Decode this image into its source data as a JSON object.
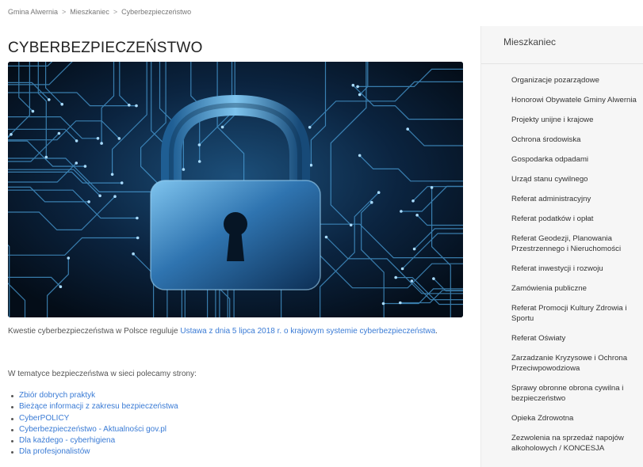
{
  "breadcrumb": {
    "items": [
      "Gmina Alwernia",
      "Mieszkaniec",
      "Cyberbezpieczeństwo"
    ],
    "separator": ">"
  },
  "page": {
    "title": "CYBERBEZPIECZEŃSTWO"
  },
  "hero": {
    "icon": "padlock-circuit-icon"
  },
  "intro": {
    "text": "Kwestie cyberbezpieczeństwa w Polsce reguluje ",
    "link": "Ustawa z dnia 5 lipca 2018 r. o krajowym systemie cyberbezpieczeństwa",
    "end": "."
  },
  "recommend": {
    "text": "W tematyce bezpieczeństwa w sieci polecamy strony:"
  },
  "links": [
    "Zbiór dobrych praktyk",
    "Bieżące informacji z zakresu bezpieczeństwa",
    "CyberPOLICY",
    "Cyberbezpieczeństwo - Aktualności gov.pl",
    "Dla każdego - cyberhigiena",
    "Dla profesjonalistów"
  ],
  "sidebar": {
    "title": "Mieszkaniec",
    "items": [
      "Organizacje pozarządowe",
      "Honorowi Obywatele Gminy Alwernia",
      "Projekty unijne i krajowe",
      "Ochrona środowiska",
      "Gospodarka odpadami",
      "Urząd stanu cywilnego",
      "Referat administracyjny",
      "Referat podatków i opłat",
      "Referat Geodezji, Planowania Przestrzennego i Nieruchomości",
      "Referat inwestycji i rozwoju",
      "Zamówienia publiczne",
      "Referat Promocji Kultury Zdrowia i Sportu",
      "Referat Oświaty",
      "Zarzadzanie Kryzysowe i Ochrona Przeciwpowodziowa",
      "Sprawy obronne obrona cywilna i bezpieczeństwo",
      "Opieka Zdrowotna",
      "Zezwolenia na sprzedaż napojów alkoholowych / KONCESJA"
    ]
  },
  "colors": {
    "link": "#3a7bd5",
    "sidebar_bg": "#f6f6f6",
    "hero_bg": "#061525",
    "circuit": "#4a9fd8"
  }
}
